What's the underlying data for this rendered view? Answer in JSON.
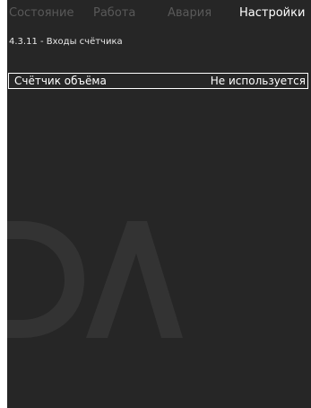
{
  "tabs": [
    {
      "label": "Состояние",
      "active": false
    },
    {
      "label": "Работа",
      "active": false
    },
    {
      "label": "Авария",
      "active": false
    },
    {
      "label": "Настройки",
      "active": true
    }
  ],
  "breadcrumb": "4.3.11 - Входы счётчика",
  "menu": {
    "items": [
      {
        "label": "Счётчик объёма",
        "value": "Не используется",
        "selected": true
      }
    ]
  },
  "colors": {
    "screen_background": "#262626",
    "inactive_tab": "#595959",
    "active_text": "#ffffff",
    "watermark": "#333333"
  }
}
